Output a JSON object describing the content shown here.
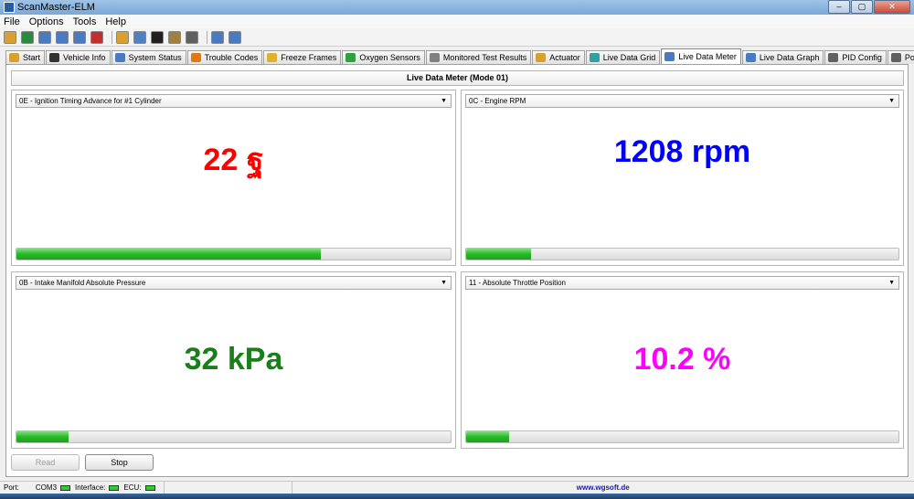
{
  "window": {
    "title": "ScanMaster-ELM",
    "buttons": [
      "–",
      "▢",
      "✕"
    ]
  },
  "menu": [
    "File",
    "Options",
    "Tools",
    "Help"
  ],
  "toolbar_icons": [
    "wrench-icon",
    "globe-icon",
    "monitor-icon",
    "grid-icon",
    "chart-icon",
    "stoplight-icon",
    "clipboard-icon",
    "chat-icon",
    "terminal-icon",
    "battery-icon",
    "device-icon",
    "info-icon",
    "book-icon"
  ],
  "tabs": [
    {
      "label": "Start",
      "icon": "home-icon",
      "color": "#d8a030"
    },
    {
      "label": "Vehicle Info",
      "icon": "info-icon",
      "color": "#333333"
    },
    {
      "label": "System Status",
      "icon": "status-icon",
      "color": "#4a7bc0"
    },
    {
      "label": "Trouble Codes",
      "icon": "warning-icon",
      "color": "#e07a10"
    },
    {
      "label": "Freeze Frames",
      "icon": "snowflake-icon",
      "color": "#e0b030"
    },
    {
      "label": "Oxygen Sensors",
      "icon": "sensor-icon",
      "color": "#30a040"
    },
    {
      "label": "Monitored Test Results",
      "icon": "gear-icon",
      "color": "#808080"
    },
    {
      "label": "Actuator",
      "icon": "actuator-icon",
      "color": "#d8a030"
    },
    {
      "label": "Live Data Grid",
      "icon": "grid-icon",
      "color": "#30a0a0"
    },
    {
      "label": "Live Data Meter",
      "icon": "meter-icon",
      "color": "#4a7bc0"
    },
    {
      "label": "Live Data Graph",
      "icon": "graph-icon",
      "color": "#4a7bc0"
    },
    {
      "label": "PID Config",
      "icon": "config-icon",
      "color": "#606060"
    },
    {
      "label": "Power",
      "icon": "power-icon",
      "color": "#606060"
    }
  ],
  "active_tab_index": 9,
  "header": "Live Data Meter (Mode 01)",
  "meters": [
    {
      "pid": "0E - Ignition Timing Advance for #1 Cylinder",
      "value": "22 ฐ",
      "color": "#ff0000",
      "level": 0.7
    },
    {
      "pid": "0C - Engine RPM",
      "value": "1208 rpm",
      "color": "#0000ff",
      "level": 0.15
    },
    {
      "pid": "0B - Intake Manifold Absolute Pressure",
      "value": "32 kPa",
      "color": "#1a7f1a",
      "level": 0.12
    },
    {
      "pid": "11 - Absolute Throttle Position",
      "value": "10.2 %",
      "color": "#ff00ff",
      "level": 0.1
    }
  ],
  "buttons": {
    "read": "Read",
    "stop": "Stop"
  },
  "status": {
    "port_label": "Port:",
    "port_value": "COM3",
    "interface_label": "Interface:",
    "ecu_label": "ECU:",
    "url": "www.wgsoft.de",
    "led_color": "#2ad12a"
  }
}
